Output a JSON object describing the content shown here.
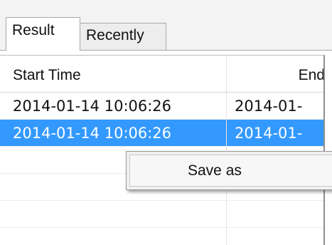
{
  "tabs": [
    {
      "label": "Result",
      "active": true
    },
    {
      "label": "Recently",
      "active": false
    }
  ],
  "table": {
    "columns": [
      "Start Time",
      "End"
    ],
    "rows": [
      {
        "start": "2014-01-14 10:06:26",
        "end": "2014-01-",
        "selected": false
      },
      {
        "start": "2014-01-14 10:06:26",
        "end": "2014-01-",
        "selected": true
      }
    ]
  },
  "context_menu": {
    "items": [
      {
        "label": "Save as"
      }
    ]
  },
  "colors": {
    "selection": "#3399ff",
    "tab_active": "#ffffff",
    "tab_inactive": "#ededed"
  }
}
